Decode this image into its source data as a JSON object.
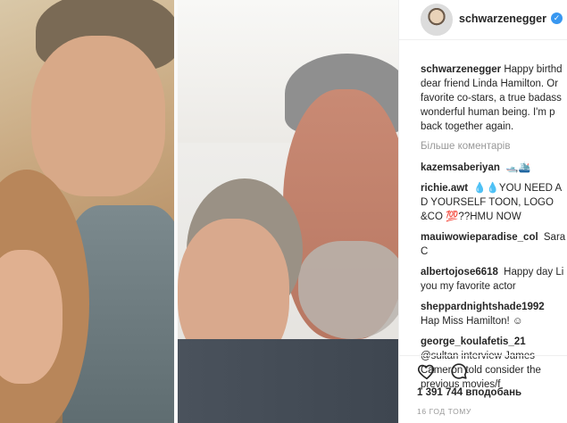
{
  "post": {
    "username": "schwarzenegger",
    "caption_user": "schwarzenegger",
    "caption_text": "Happy birthd dear friend Linda Hamilton. Or favorite co-stars, a true badass wonderful human being. I'm p back together again.",
    "more_comments_label": "Більше коментарів",
    "likes_text": "1 391 744 вподобань",
    "time_text": "16 ГОД ТОМУ"
  },
  "comments": [
    {
      "user": "kazemsaberiyan",
      "text": "🛥️🛳️"
    },
    {
      "user": "richie.awt",
      "text": "💧💧YOU NEED A D YOURSELF TOON, LOGO &CO 💯??HMU NOW"
    },
    {
      "user": "mauiwowieparadise_col",
      "text": "Sara C"
    },
    {
      "user": "albertojose6618",
      "text": "Happy day Li you my favorite actor"
    },
    {
      "user": "sheppardnightshade1992",
      "text": "Hap Miss Hamilton! ☺"
    },
    {
      "user": "george_koulafetis_21",
      "text": "@sultan interview James Cameron told consider the previous movies/f"
    }
  ],
  "icons": {
    "verified": "verified-badge-icon",
    "like": "heart-icon",
    "comment": "comment-bubble-icon"
  },
  "colors": {
    "accent": "#3897f0",
    "text": "#262626",
    "muted": "#999999",
    "divider": "#efefef"
  }
}
